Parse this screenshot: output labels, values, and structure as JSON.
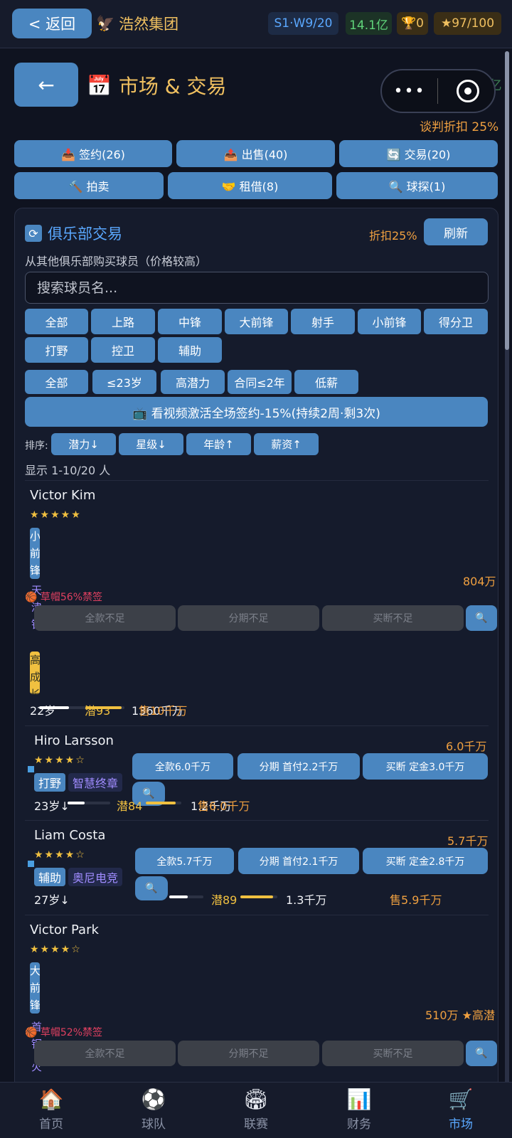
{
  "header": {
    "back_label": "< 返回",
    "club_icon": "eagle-icon",
    "club_name": "浩然集团",
    "season": "S1·W9/20",
    "money": "14.1亿",
    "trophy": "🏆0",
    "rating": "★97/100"
  },
  "market": {
    "title": "市场 & 交易",
    "title_icon": "calendar-icon",
    "back_arrow": "←",
    "capsule_dots": "•••",
    "money_hidden": "💰14.1亿",
    "negotiate_discount": "谈判折扣 25%"
  },
  "tabs": [
    {
      "label": "📥 签约(26)"
    },
    {
      "label": "📤 出售(40)"
    },
    {
      "label": "🔄 交易(20)"
    },
    {
      "label": "🔨 拍卖"
    },
    {
      "label": "🤝 租借(8)"
    },
    {
      "label": "🔍 球探(1)"
    }
  ],
  "section": {
    "title": "俱乐部交易",
    "discount": "折扣25%",
    "refresh_label": "刷新",
    "subtitle": "从其他俱乐部购买球员（价格较高）",
    "search_placeholder": "搜索球员名..."
  },
  "position_filters": [
    "全部",
    "上路",
    "中锋",
    "大前锋",
    "射手",
    "小前锋",
    "得分卫",
    "打野",
    "控卫",
    "辅助"
  ],
  "attr_filters": [
    "全部",
    "≤23岁",
    "高潜力",
    "合同≤2年",
    "低薪"
  ],
  "video_label": "📺 看视频激活全场签约-15%(持续2周·剩3次)",
  "sort": {
    "label": "排序:",
    "options": [
      "潜力↓",
      "星级↓",
      "年龄↑",
      "薪资↑"
    ]
  },
  "showing": "显示 1-10/20 人",
  "players": [
    {
      "name": "Victor Kim",
      "stars": "★★★★★",
      "pos": "小前锋",
      "club": "天津钢",
      "trait": "高成长",
      "ban": "🏀 草帽56%禁签",
      "price": "804万",
      "btn_full": "全款不足",
      "btn_install": "分期不足",
      "btn_buyout": "买断不足",
      "age": "22岁",
      "pot": "潜93",
      "salary": "1360千万",
      "sell": "售10千万",
      "potential": 0.93
    },
    {
      "name": "Hiro Larsson",
      "stars": "★★★★☆",
      "pos": "打野",
      "trait": "智慧终章",
      "price": "6.0千万",
      "btn_full": "全款6.0千万",
      "btn_install": "分期 首付2.2千万",
      "btn_buyout": "买断 定金3.0千万",
      "age": "23岁↓",
      "pot": "潜84",
      "salary": "1.2千万",
      "sell": "售6.0千万",
      "potential": 0.84
    },
    {
      "name": "Liam Costa",
      "stars": "★★★★☆",
      "pos": "辅助",
      "trait": "奥尼电竞",
      "price": "5.7千万",
      "btn_full": "全款5.7千万",
      "btn_install": "分期 首付2.1千万",
      "btn_buyout": "买断 定金2.8千万",
      "age": "27岁↓",
      "pot": "潜89",
      "salary": "1.3千万",
      "sell": "售5.9千万",
      "potential": 0.89
    },
    {
      "name": "Victor Park",
      "stars": "★★★★☆",
      "pos": "大前锋",
      "club": "首钢",
      "trait": "火花",
      "ban": "🏀 草帽52%禁签",
      "price": "510万 ★高潜",
      "btn_full": "全款不足",
      "btn_install": "分期不足",
      "btn_buyout": "买断不足"
    }
  ],
  "nav": [
    {
      "label": "首页",
      "icon": "🏠"
    },
    {
      "label": "球队",
      "icon": "⚽"
    },
    {
      "label": "联赛",
      "icon": "🏟"
    },
    {
      "label": "财务",
      "icon": "📊"
    },
    {
      "label": "市场",
      "icon": "🛒"
    }
  ],
  "colors": {
    "accent": "#4a86c0",
    "gold": "#f0c060",
    "orange": "#f0a040",
    "green": "#5fd37a",
    "bg": "#0f1320"
  }
}
